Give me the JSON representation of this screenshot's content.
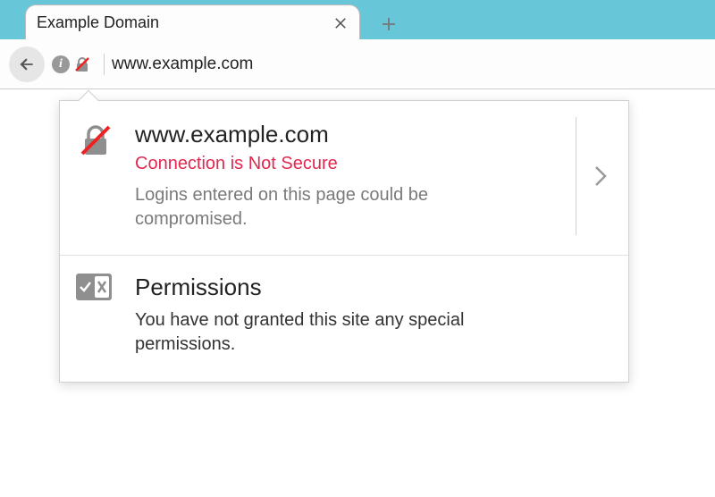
{
  "tab": {
    "title": "Example Domain"
  },
  "urlbar": {
    "value": "www.example.com"
  },
  "popup": {
    "security": {
      "host": "www.example.com",
      "status": "Connection is Not Secure",
      "description": "Logins entered on this page could be compromised."
    },
    "permissions": {
      "title": "Permissions",
      "description": "You have not granted this site any special permissions."
    }
  }
}
